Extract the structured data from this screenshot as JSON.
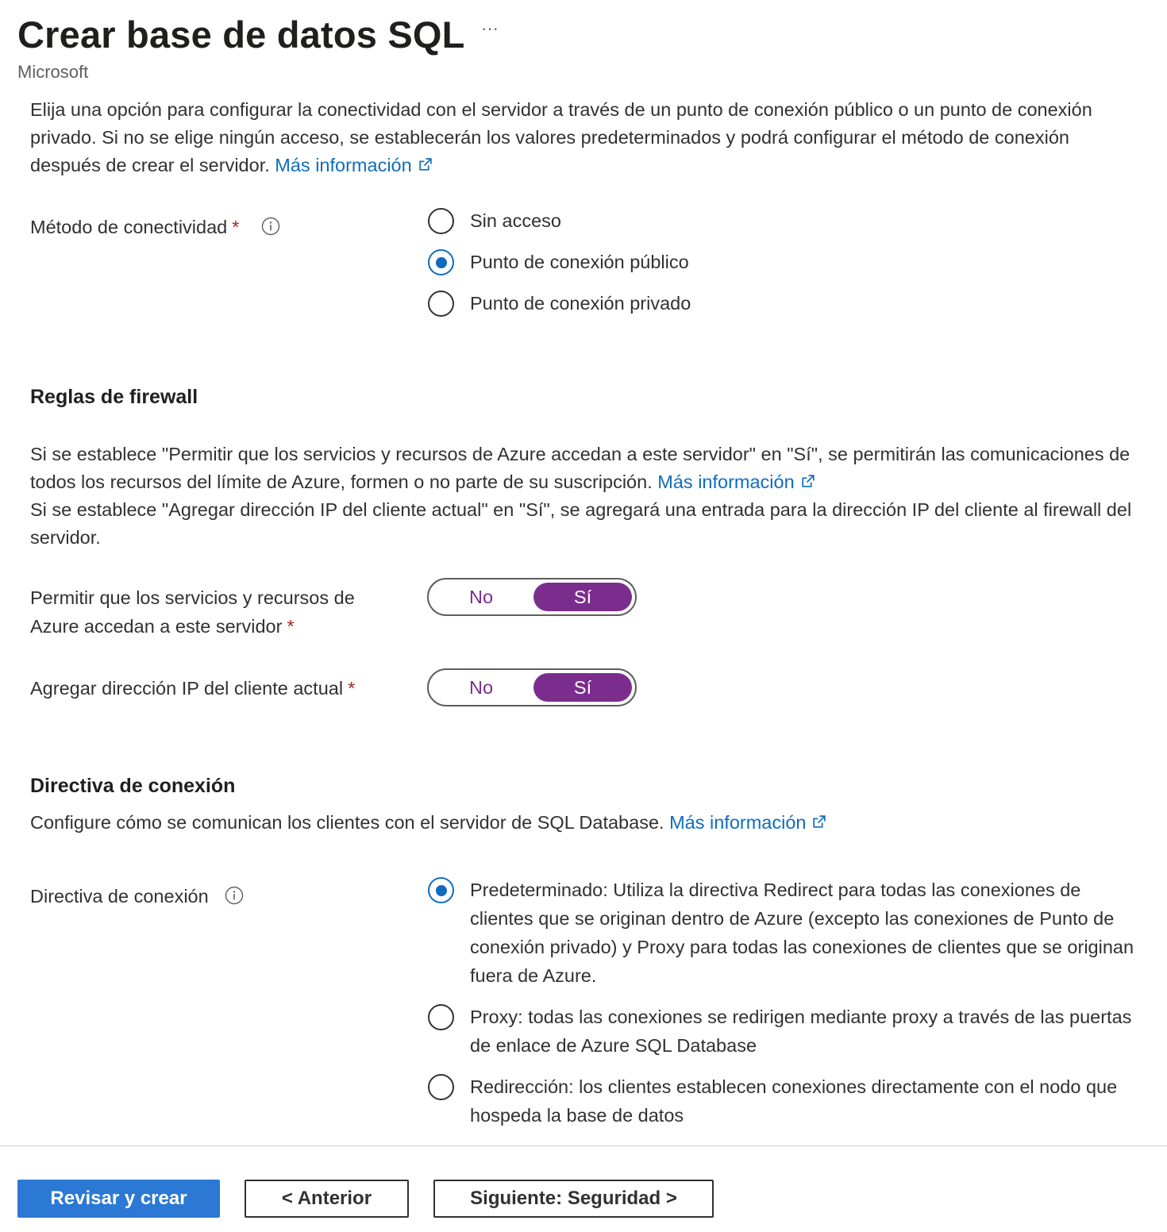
{
  "header": {
    "title": "Crear base de datos SQL",
    "more_label": "···",
    "subtitle": "Microsoft"
  },
  "connectivity": {
    "description": "Elija una opción para configurar la conectividad con el servidor a través de un punto de conexión público o un punto de conexión privado. Si no se elige ningún acceso, se establecerán los valores predeterminados y podrá configurar el método de conexión después de crear el servidor.",
    "link": "Más información",
    "label": "Método de conectividad",
    "required_mark": "*",
    "options": [
      {
        "label": "Sin acceso",
        "selected": false
      },
      {
        "label": "Punto de conexión público",
        "selected": true
      },
      {
        "label": "Punto de conexión privado",
        "selected": false
      }
    ]
  },
  "firewall": {
    "heading": "Reglas de firewall",
    "description_1": "Si se establece \"Permitir que los servicios y recursos de Azure accedan a este servidor\" en \"Sí\", se permitirán las comunicaciones de todos los recursos del límite de Azure, formen o no parte de su suscripción.",
    "link": "Más información",
    "description_2": "Si se establece \"Agregar dirección IP del cliente actual\" en \"Sí\", se agregará una entrada para la dirección IP del cliente al firewall del servidor.",
    "allow_azure": {
      "label": "Permitir que los servicios y recursos de Azure accedan a este servidor",
      "required_mark": "*",
      "no_label": "No",
      "yes_label": "Sí",
      "value": "Sí"
    },
    "add_client_ip": {
      "label": "Agregar dirección IP del cliente actual",
      "required_mark": "*",
      "no_label": "No",
      "yes_label": "Sí",
      "value": "Sí"
    }
  },
  "connection_policy": {
    "heading": "Directiva de conexión",
    "description": "Configure cómo se comunican los clientes con el servidor de SQL Database.",
    "link": "Más información",
    "label": "Directiva de conexión",
    "options": [
      {
        "label": "Predeterminado: Utiliza la directiva Redirect para todas las conexiones de clientes que se originan dentro de Azure (excepto las conexiones de Punto de conexión privado) y Proxy para todas las conexiones de clientes que se originan fuera de Azure.",
        "selected": true
      },
      {
        "label": "Proxy: todas las conexiones se redirigen mediante proxy a través de las puertas de enlace de Azure SQL Database",
        "selected": false
      },
      {
        "label": "Redirección: los clientes establecen conexiones directamente con el nodo que hospeda la base de datos",
        "selected": false
      }
    ]
  },
  "footer": {
    "review_create": "Revisar y crear",
    "previous": "< Anterior",
    "next": "Siguiente: Seguridad >"
  },
  "colors": {
    "link": "#0f6cbd",
    "radio_selected": "#0f6cbd",
    "toggle_selected": "#7b2d8e",
    "primary_button": "#2b79d4",
    "required": "#a4262c"
  },
  "icons": {
    "more": "ellipsis-icon",
    "info": "info-icon",
    "external_link": "external-link-icon"
  }
}
